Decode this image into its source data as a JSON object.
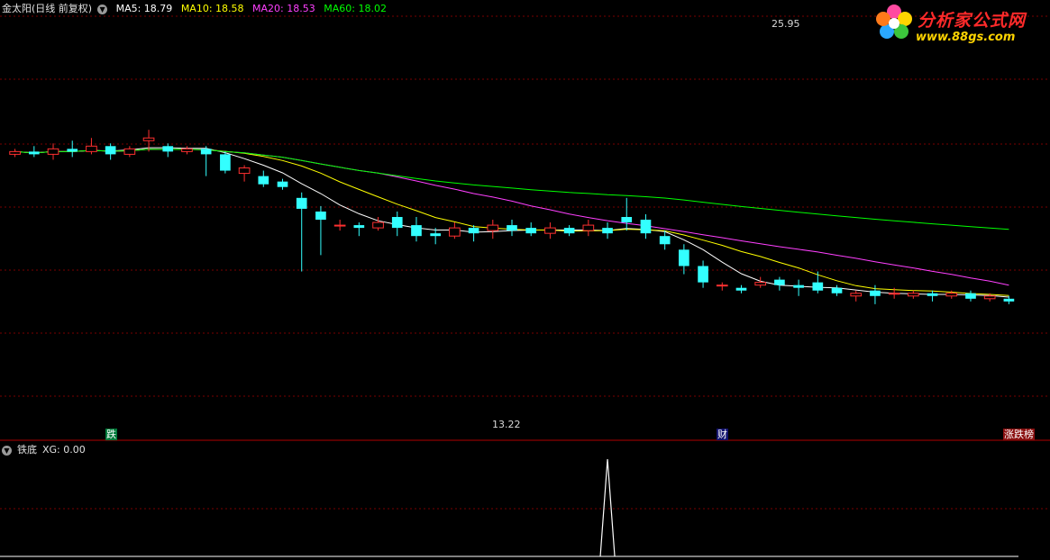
{
  "main_panel": {
    "title": "金太阳(日线 前复权)",
    "ma_labels": [
      {
        "text": "MA5: 18.79",
        "color": "#ffffff"
      },
      {
        "text": "MA10: 18.58",
        "color": "#ffff00"
      },
      {
        "text": "MA20: 18.53",
        "color": "#ff40ff"
      },
      {
        "text": "MA60: 18.02",
        "color": "#00ff00"
      }
    ],
    "high_label": "25.95",
    "low_label": "13.22",
    "signals": [
      {
        "text": "跌",
        "bg": "#007a3a",
        "color": "#ffffff",
        "day": 5
      },
      {
        "text": "财",
        "bg": "#12126e",
        "color": "#ffffff",
        "day": 37
      },
      {
        "text": "涨跌榜",
        "bg": "#8a0f0f",
        "color": "#ffffff",
        "day": 52
      }
    ]
  },
  "sub_panel": {
    "title": "铁底",
    "indicator_label": "XG: 0.00",
    "spike_day": 31
  },
  "logo": {
    "title": "分析家公式网",
    "url": "www.88gs.com"
  },
  "chart_data": {
    "type": "candlestick",
    "price_range": [
      12.5,
      27.5
    ],
    "grid": "dashed-red",
    "colors": {
      "up": "#ff3030",
      "down": "#33ffff",
      "ma5": "#ffffff",
      "ma10": "#ffff00",
      "ma20": "#ff40ff",
      "ma60": "#00ff00"
    },
    "candles": [
      [
        22.3,
        22.4,
        22.2,
        22.5
      ],
      [
        22.4,
        22.3,
        22.2,
        22.6
      ],
      [
        22.3,
        22.5,
        22.1,
        22.7
      ],
      [
        22.5,
        22.4,
        22.2,
        22.8
      ],
      [
        22.4,
        22.6,
        22.3,
        22.9
      ],
      [
        22.6,
        22.3,
        22.1,
        22.7
      ],
      [
        22.3,
        22.5,
        22.2,
        22.6
      ],
      [
        22.8,
        22.9,
        22.4,
        23.2
      ],
      [
        22.6,
        22.4,
        22.2,
        22.7
      ],
      [
        22.4,
        22.5,
        22.3,
        22.6
      ],
      [
        22.5,
        22.3,
        21.5,
        22.6
      ],
      [
        22.3,
        21.7,
        21.6,
        22.4
      ],
      [
        21.6,
        21.8,
        21.3,
        21.9
      ],
      [
        21.5,
        21.2,
        21.1,
        21.7
      ],
      [
        21.3,
        21.1,
        21.0,
        21.4
      ],
      [
        20.7,
        20.3,
        18.0,
        20.9
      ],
      [
        20.2,
        19.9,
        18.6,
        20.4
      ],
      [
        19.7,
        19.7,
        19.5,
        19.9
      ],
      [
        19.7,
        19.6,
        19.3,
        19.8
      ],
      [
        19.6,
        19.8,
        19.5,
        20.0
      ],
      [
        20.0,
        19.6,
        19.3,
        20.2
      ],
      [
        19.7,
        19.3,
        19.1,
        20.0
      ],
      [
        19.4,
        19.3,
        19.0,
        19.6
      ],
      [
        19.3,
        19.6,
        19.2,
        19.8
      ],
      [
        19.6,
        19.4,
        19.1,
        19.7
      ],
      [
        19.5,
        19.7,
        19.2,
        19.9
      ],
      [
        19.7,
        19.5,
        19.3,
        19.9
      ],
      [
        19.6,
        19.4,
        19.3,
        19.8
      ],
      [
        19.4,
        19.6,
        19.2,
        19.8
      ],
      [
        19.6,
        19.4,
        19.3,
        19.7
      ],
      [
        19.5,
        19.7,
        19.3,
        19.9
      ],
      [
        19.6,
        19.4,
        19.2,
        19.8
      ],
      [
        20.0,
        19.8,
        19.5,
        20.7
      ],
      [
        19.9,
        19.4,
        19.2,
        20.1
      ],
      [
        19.3,
        19.0,
        18.8,
        19.5
      ],
      [
        18.8,
        18.2,
        17.9,
        19.0
      ],
      [
        18.2,
        17.6,
        17.4,
        18.4
      ],
      [
        17.5,
        17.5,
        17.3,
        17.6
      ],
      [
        17.4,
        17.3,
        17.2,
        17.5
      ],
      [
        17.5,
        17.6,
        17.4,
        17.8
      ],
      [
        17.7,
        17.5,
        17.3,
        17.8
      ],
      [
        17.5,
        17.4,
        17.1,
        17.7
      ],
      [
        17.6,
        17.3,
        17.2,
        18.0
      ],
      [
        17.4,
        17.2,
        17.1,
        17.5
      ],
      [
        17.1,
        17.2,
        16.9,
        17.3
      ],
      [
        17.3,
        17.1,
        16.8,
        17.5
      ],
      [
        17.2,
        17.2,
        17.0,
        17.4
      ],
      [
        17.1,
        17.2,
        17.0,
        17.3
      ],
      [
        17.2,
        17.1,
        16.9,
        17.3
      ],
      [
        17.1,
        17.2,
        17.0,
        17.3
      ],
      [
        17.2,
        17.0,
        16.9,
        17.3
      ],
      [
        17.0,
        17.1,
        16.9,
        17.2
      ],
      [
        17.0,
        16.9,
        16.8,
        17.1
      ]
    ]
  }
}
